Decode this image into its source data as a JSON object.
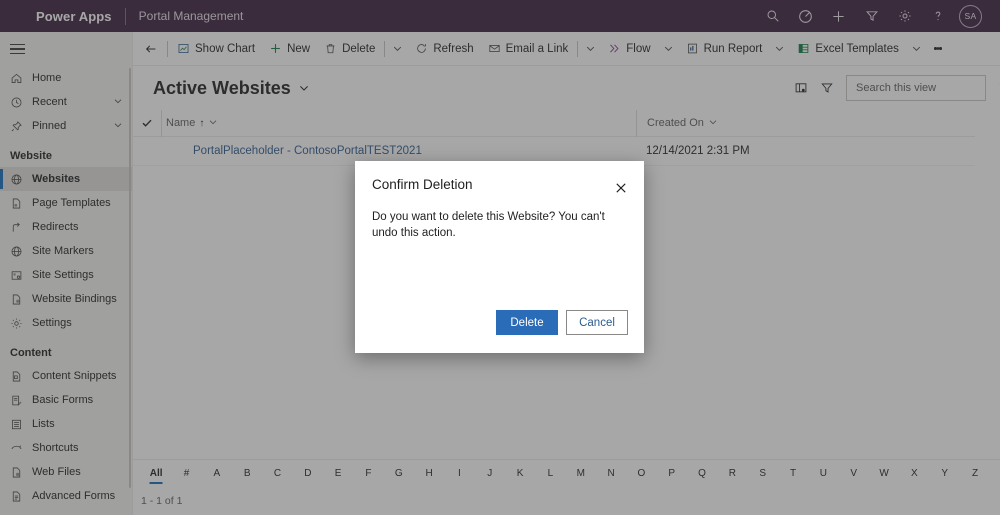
{
  "brand": {
    "app_name": "Power Apps",
    "environment": "Portal Management",
    "icons": [
      "search-icon",
      "target-icon",
      "plus-icon",
      "filter-icon",
      "gear-icon",
      "help-icon"
    ],
    "avatar_initials": "SA"
  },
  "sidebar": {
    "hamburger": "hamburger-menu",
    "top_items": [
      {
        "label": "Home",
        "icon": "home-icon",
        "chevron": false
      },
      {
        "label": "Recent",
        "icon": "clock-icon",
        "chevron": true
      },
      {
        "label": "Pinned",
        "icon": "pin-icon",
        "chevron": true
      }
    ],
    "groups": [
      {
        "title": "Website",
        "items": [
          {
            "label": "Websites",
            "icon": "globe-icon",
            "selected": true
          },
          {
            "label": "Page Templates",
            "icon": "page-icon",
            "selected": false
          },
          {
            "label": "Redirects",
            "icon": "redirect-icon",
            "selected": false
          },
          {
            "label": "Site Markers",
            "icon": "globe-icon",
            "selected": false
          },
          {
            "label": "Site Settings",
            "icon": "settings-grid-icon",
            "selected": false
          },
          {
            "label": "Website Bindings",
            "icon": "binding-icon",
            "selected": false
          },
          {
            "label": "Settings",
            "icon": "gear-icon",
            "selected": false
          }
        ]
      },
      {
        "title": "Content",
        "items": [
          {
            "label": "Content Snippets",
            "icon": "snippet-icon",
            "selected": false
          },
          {
            "label": "Basic Forms",
            "icon": "form-icon",
            "selected": false
          },
          {
            "label": "Lists",
            "icon": "list-icon",
            "selected": false
          },
          {
            "label": "Shortcuts",
            "icon": "shortcut-icon",
            "selected": false
          },
          {
            "label": "Web Files",
            "icon": "file-icon",
            "selected": false
          },
          {
            "label": "Advanced Forms",
            "icon": "advanced-form-icon",
            "selected": false
          }
        ]
      }
    ]
  },
  "commandbar": {
    "back": "back-arrow-icon",
    "items": [
      {
        "label": "Show Chart",
        "icon": "chart-icon",
        "chevron": false
      },
      {
        "label": "New",
        "icon": "plus-icon",
        "chevron": false
      },
      {
        "label": "Delete",
        "icon": "trash-icon",
        "chevron": true
      },
      {
        "label": "Refresh",
        "icon": "refresh-icon",
        "chevron": false
      },
      {
        "label": "Email a Link",
        "icon": "email-icon",
        "chevron": true
      },
      {
        "label": "Flow",
        "icon": "flow-icon",
        "chevron": true
      },
      {
        "label": "Run Report",
        "icon": "report-icon",
        "chevron": true
      },
      {
        "label": "Excel Templates",
        "icon": "excel-icon",
        "chevron": true
      }
    ],
    "overflow": "more-commands-icon"
  },
  "view": {
    "title": "Active Websites",
    "title_chevron": "chevron-down-icon",
    "edit_columns_icon": "edit-columns-icon",
    "filter_icon": "filter-icon",
    "search": {
      "placeholder": "Search this view",
      "value": "",
      "icon": "search-icon"
    }
  },
  "grid": {
    "select_all_icon": "checkmark-icon",
    "columns": [
      {
        "label": "Name",
        "sort": "↑"
      },
      {
        "label": "Created On",
        "sort": ""
      }
    ],
    "rows": [
      {
        "name": "PortalPlaceholder - ContosoPortalTEST2021",
        "created_on": "12/14/2021 2:31 PM"
      }
    ]
  },
  "alpha_bar": {
    "items": [
      "All",
      "#",
      "A",
      "B",
      "C",
      "D",
      "E",
      "F",
      "G",
      "H",
      "I",
      "J",
      "K",
      "L",
      "M",
      "N",
      "O",
      "P",
      "Q",
      "R",
      "S",
      "T",
      "U",
      "V",
      "W",
      "X",
      "Y",
      "Z"
    ],
    "active": "All"
  },
  "status": {
    "record_count": "1 - 1 of 1"
  },
  "dialog": {
    "title": "Confirm Deletion",
    "close_icon": "close-icon",
    "message": "Do you want to delete this Website? You can't undo this action.",
    "primary_button": "Delete",
    "secondary_button": "Cancel"
  },
  "colors": {
    "brand_bar": "#3b1f3f",
    "accent": "#0f6cbd",
    "primary_button": "#2b6cb8",
    "link": "#2c5c8f"
  }
}
